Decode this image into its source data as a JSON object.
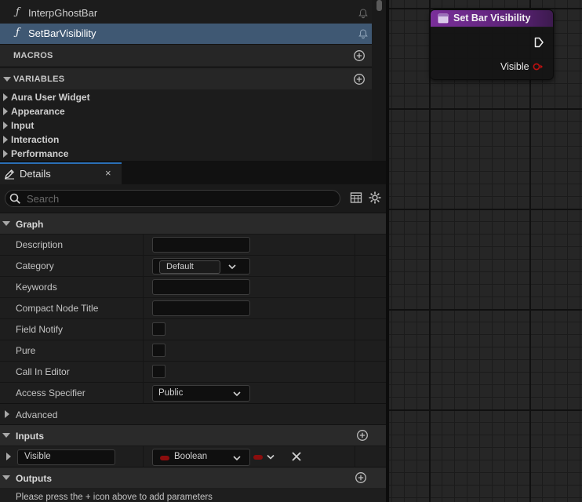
{
  "my_blueprint": {
    "functions": [
      {
        "glyph": "ƒ",
        "label": "InterpGhostBar",
        "selected": false
      },
      {
        "glyph": "ƒ",
        "label": "SetBarVisibility",
        "selected": true
      }
    ],
    "macros_label": "MACROS",
    "variables_label": "VARIABLES",
    "variable_categories": [
      "Aura User Widget",
      "Appearance",
      "Input",
      "Interaction",
      "Performance"
    ]
  },
  "details": {
    "tab_label": "Details",
    "close_glyph": "×",
    "search_placeholder": "Search",
    "graph_section": "Graph",
    "properties": {
      "description": {
        "label": "Description",
        "value": ""
      },
      "category": {
        "label": "Category",
        "value": "Default"
      },
      "keywords": {
        "label": "Keywords",
        "value": ""
      },
      "compact_node_title": {
        "label": "Compact Node Title",
        "value": ""
      },
      "field_notify": {
        "label": "Field Notify",
        "checked": false
      },
      "pure": {
        "label": "Pure",
        "checked": false
      },
      "call_in_editor": {
        "label": "Call In Editor",
        "checked": false
      },
      "access_specifier": {
        "label": "Access Specifier",
        "value": "Public"
      }
    },
    "advanced_label": "Advanced",
    "inputs_label": "Inputs",
    "input_params": [
      {
        "name": "Visible",
        "type": "Boolean",
        "type_color": "#8b0d0d"
      }
    ],
    "outputs_label": "Outputs",
    "outputs_hint": "Please press the + icon above to add parameters"
  },
  "graph": {
    "node": {
      "title": "Set Bar Visibility",
      "header_color": "#6e2a8c",
      "pins": [
        {
          "label": "Visible",
          "type": "Boolean",
          "color": "#c01010"
        }
      ]
    }
  }
}
